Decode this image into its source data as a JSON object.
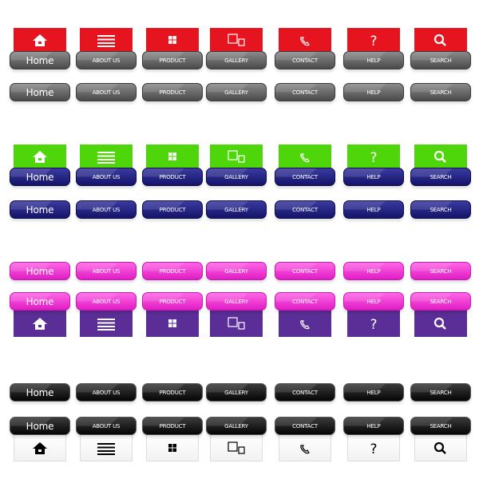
{
  "nav_items": [
    {
      "label": "Home",
      "icon": "home-icon"
    },
    {
      "label": "ABOUT US",
      "icon": "menu-lines-icon"
    },
    {
      "label": "PRODUCT",
      "icon": "grid-icon"
    },
    {
      "label": "GALLERY",
      "icon": "gallery-squares-icon"
    },
    {
      "label": "CONTACT",
      "icon": "phone-icon"
    },
    {
      "label": "HELP",
      "icon": "question-icon"
    },
    {
      "label": "SEARCH",
      "icon": "search-icon"
    }
  ],
  "themes": {
    "gray": {
      "top": "#8a8a8a",
      "bottom": "#4a4a4a",
      "border": "#3a3a3a"
    },
    "navy": {
      "top": "#3a3aa0",
      "bottom": "#14146a",
      "border": "#0c0c4a"
    },
    "pink": {
      "top": "#ff66e6",
      "bottom": "#e01cc4",
      "border": "#c61aae"
    },
    "black": {
      "top": "#3a3a3a",
      "bottom": "#050505",
      "border": "#555555"
    },
    "red": {
      "tab": "#e5141f",
      "icon": "#ffffff"
    },
    "green": {
      "tab": "#4fd60a",
      "icon": "#ffffff"
    },
    "purple": {
      "tab": "#5a2e96",
      "icon": "#ffffff"
    },
    "white": {
      "tab": "#ffffff",
      "icon": "#000000"
    }
  }
}
